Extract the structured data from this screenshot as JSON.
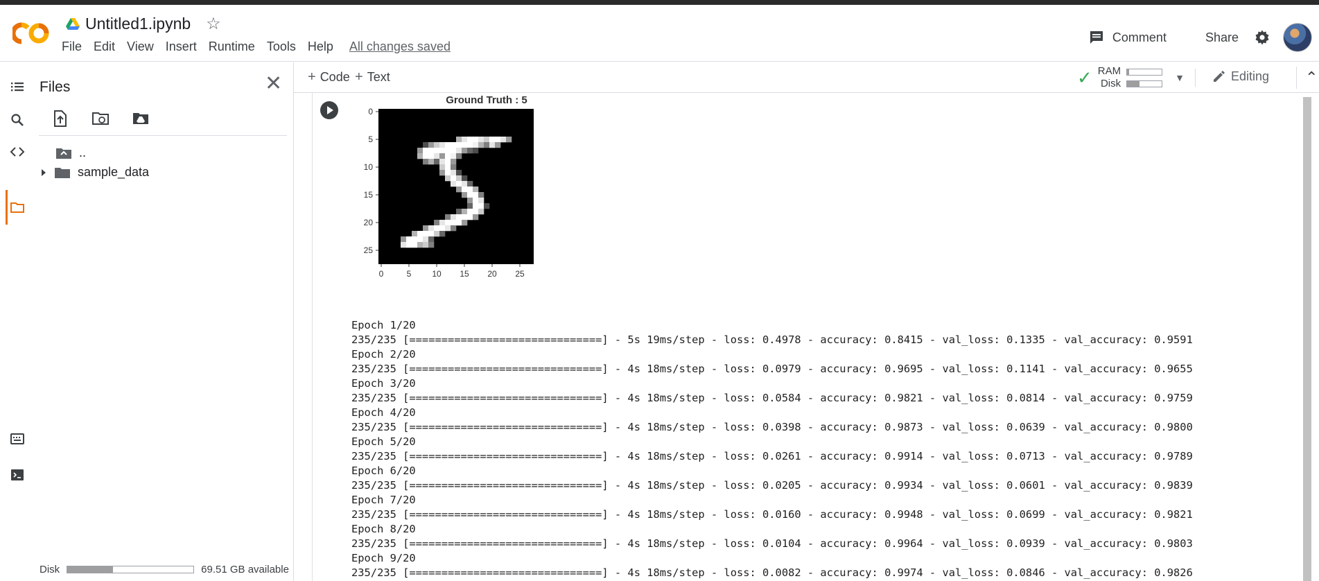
{
  "header": {
    "title": "Untitled1.ipynb",
    "menu": [
      "File",
      "Edit",
      "View",
      "Insert",
      "Runtime",
      "Tools",
      "Help"
    ],
    "save_status": "All changes saved",
    "comment_label": "Comment",
    "share_label": "Share",
    "icons": [
      "colab-logo-icon",
      "drive-icon",
      "star-icon",
      "comment-icon",
      "gear-icon",
      "avatar"
    ]
  },
  "rail": {
    "icons": [
      "toc-icon",
      "search-icon",
      "code-snippets-icon",
      "folder-icon",
      "command-palette-icon",
      "terminal-icon"
    ],
    "active": "folder-icon"
  },
  "files": {
    "title": "Files",
    "tree": [
      {
        "label": ".."
      },
      {
        "label": "sample_data"
      }
    ],
    "disk_label": "Disk",
    "disk_available": "69.51 GB available",
    "disk_used_fraction": 0.36
  },
  "toolbar": {
    "code_label": "Code",
    "text_label": "Text",
    "ram_label": "RAM",
    "disk_label": "Disk",
    "ram_used_fraction": 0.05,
    "disk_used_fraction": 0.36,
    "editing_label": "Editing"
  },
  "figure": {
    "title": "Ground Truth : 5",
    "xticks": [
      "0",
      "5",
      "10",
      "15",
      "20",
      "25"
    ],
    "yticks": [
      "0",
      "5",
      "10",
      "15",
      "20",
      "25"
    ],
    "image_size": 28
  },
  "log": [
    "Epoch 1/20",
    "235/235 [==============================] - 5s 19ms/step - loss: 0.4978 - accuracy: 0.8415 - val_loss: 0.1335 - val_accuracy: 0.9591",
    "Epoch 2/20",
    "235/235 [==============================] - 4s 18ms/step - loss: 0.0979 - accuracy: 0.9695 - val_loss: 0.1141 - val_accuracy: 0.9655",
    "Epoch 3/20",
    "235/235 [==============================] - 4s 18ms/step - loss: 0.0584 - accuracy: 0.9821 - val_loss: 0.0814 - val_accuracy: 0.9759",
    "Epoch 4/20",
    "235/235 [==============================] - 4s 18ms/step - loss: 0.0398 - accuracy: 0.9873 - val_loss: 0.0639 - val_accuracy: 0.9800",
    "Epoch 5/20",
    "235/235 [==============================] - 4s 18ms/step - loss: 0.0261 - accuracy: 0.9914 - val_loss: 0.0713 - val_accuracy: 0.9789",
    "Epoch 6/20",
    "235/235 [==============================] - 4s 18ms/step - loss: 0.0205 - accuracy: 0.9934 - val_loss: 0.0601 - val_accuracy: 0.9839",
    "Epoch 7/20",
    "235/235 [==============================] - 4s 18ms/step - loss: 0.0160 - accuracy: 0.9948 - val_loss: 0.0699 - val_accuracy: 0.9821",
    "Epoch 8/20",
    "235/235 [==============================] - 4s 18ms/step - loss: 0.0104 - accuracy: 0.9964 - val_loss: 0.0939 - val_accuracy: 0.9803",
    "Epoch 9/20",
    "235/235 [==============================] - 4s 18ms/step - loss: 0.0082 - accuracy: 0.9974 - val_loss: 0.0846 - val_accuracy: 0.9826"
  ],
  "colors": {
    "accent": "#e8710a",
    "check": "#34a853"
  }
}
